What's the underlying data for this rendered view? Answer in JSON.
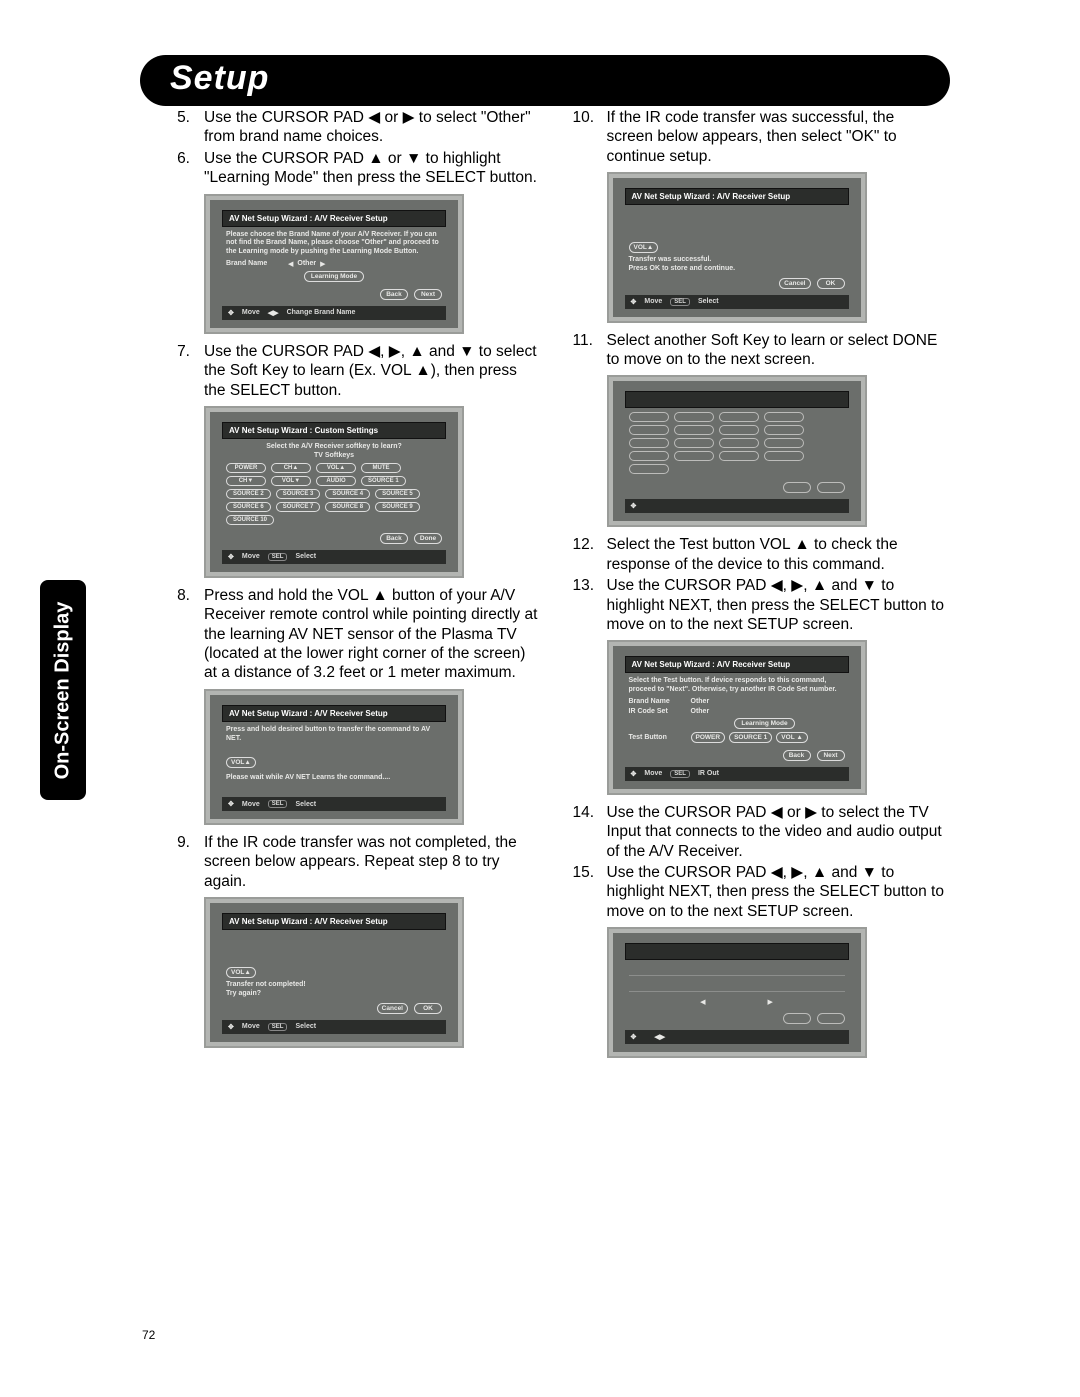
{
  "page_number": "72",
  "chapter_title": "Setup",
  "side_tab": "On-Screen Display",
  "arrows": {
    "left": "◀",
    "right": "▶",
    "up": "▲",
    "down": "▼",
    "quad": "✥",
    "lr": "◀▶"
  },
  "steps": {
    "s5": {
      "num": "5.",
      "text_a": "Use the CURSOR PAD  ",
      "text_b": " or ",
      "text_c": " to select \"Other\" from brand name choices."
    },
    "s6": {
      "num": "6.",
      "text_a": "Use the CURSOR PAD ",
      "text_b": " or ",
      "text_c": " to highlight \"Learning Mode\" then press the SELECT button."
    },
    "s7": {
      "num": "7.",
      "text_a": "Use the CURSOR PAD ",
      "comma1": ", ",
      "comma2": ", ",
      "and": " and ",
      "text_b": " to select the Soft Key to learn (Ex. VOL ",
      "text_c": "), then press the SELECT button."
    },
    "s8": {
      "num": "8.",
      "text_a": "Press and hold the VOL ",
      "text_b": " button of your A/V Receiver remote control while pointing directly at the learning AV NET sensor of the Plasma TV (located at the lower right corner of the screen) at a distance of 3.2 feet or 1 meter maximum."
    },
    "s9": {
      "num": "9.",
      "text": "If the IR code transfer was not completed, the screen below appears.  Repeat step 8 to try again."
    },
    "s10": {
      "num": "10.",
      "text": "If the IR code transfer was successful, the screen below appears, then select \"OK\" to continue setup."
    },
    "s11": {
      "num": "11.",
      "text": "Select another Soft Key to learn or select DONE to move on to the next screen."
    },
    "s12": {
      "num": "12.",
      "text_a": "Select the Test button VOL ",
      "text_b": " to check the response of the device to this command."
    },
    "s13": {
      "num": "13.",
      "text_a": "Use the CURSOR PAD ",
      "comma1": ", ",
      "comma2": ", ",
      "and": " and ",
      "text_b": " to highlight NEXT, then press the SELECT button to move on to the next SETUP screen."
    },
    "s14": {
      "num": "14.",
      "text_a": "Use the CURSOR PAD ",
      "or": " or ",
      "text_b": " to select the TV Input that connects to the video and audio output of the A/V Receiver."
    },
    "s15": {
      "num": "15.",
      "text_a": "Use the CURSOR PAD ",
      "comma1": ", ",
      "comma2": ", ",
      "and": " and ",
      "text_b": " to highlight NEXT, then press the SELECT button to move on to the next SETUP screen."
    }
  },
  "screens": {
    "a": {
      "title": "AV Net Setup Wizard : A/V Receiver Setup",
      "body": "Please choose the Brand Name of your A/V Receiver. If you can not find the Brand Name, please choose \"Other\" and proceed to the Learning mode by pushing the Learning Mode Button.",
      "brand_label": "Brand Name",
      "brand_value": "Other",
      "learning_btn": "Learning Mode",
      "back": "Back",
      "next": "Next",
      "footer_a": "Move",
      "footer_b": "Change Brand Name"
    },
    "b": {
      "title": "AV Net Setup Wizard : Custom Settings",
      "sub1": "Select the A/V Receiver softkey to learn?",
      "sub2": "TV Softkeys",
      "keys": [
        "POWER",
        "CH▲",
        "VOL▲",
        "MUTE",
        "CH▼",
        "VOL▼",
        "AUDIO",
        "SOURCE 1",
        "SOURCE 2",
        "SOURCE 3",
        "SOURCE 4",
        "SOURCE 5",
        "SOURCE 6",
        "SOURCE 7",
        "SOURCE 8",
        "SOURCE 9",
        "SOURCE 10"
      ],
      "back": "Back",
      "done": "Done",
      "footer_a": "Move",
      "footer_b": "Select"
    },
    "c": {
      "title": "AV Net Setup Wizard : A/V Receiver Setup",
      "body": "Press and hold desired button to transfer the command to AV NET.",
      "vol": "VOL▲",
      "wait": "Please wait while AV NET Learns the command....",
      "footer_a": "Move",
      "footer_b": "Select"
    },
    "d": {
      "title": "AV Net Setup Wizard : A/V Receiver Setup",
      "vol": "VOL▲",
      "msg": "Transfer not completed!\nTry again?",
      "cancel": "Cancel",
      "ok": "OK",
      "footer_a": "Move",
      "footer_b": "Select"
    },
    "e": {
      "title": "AV Net Setup Wizard : A/V Receiver Setup",
      "vol": "VOL▲",
      "msg": "Transfer was successful.\nPress OK to store and continue.",
      "cancel": "Cancel",
      "ok": "OK",
      "footer_a": "Move",
      "footer_b": "Select"
    },
    "g": {
      "title": "AV Net Setup Wizard : A/V Receiver Setup",
      "body": "Select the Test button.  If device responds to this command, proceed to \"Next\".  Otherwise, try another IR Code Set number.",
      "brand_label": "Brand Name",
      "brand_value": "Other",
      "code_label": "IR Code Set",
      "code_value": "Other",
      "learning_btn": "Learning Mode",
      "test_label": "Test Button",
      "test_btns": [
        "POWER",
        "SOURCE 1",
        "VOL ▲"
      ],
      "back": "Back",
      "next": "Next",
      "footer_a": "Move",
      "footer_b": "IR Out"
    }
  }
}
